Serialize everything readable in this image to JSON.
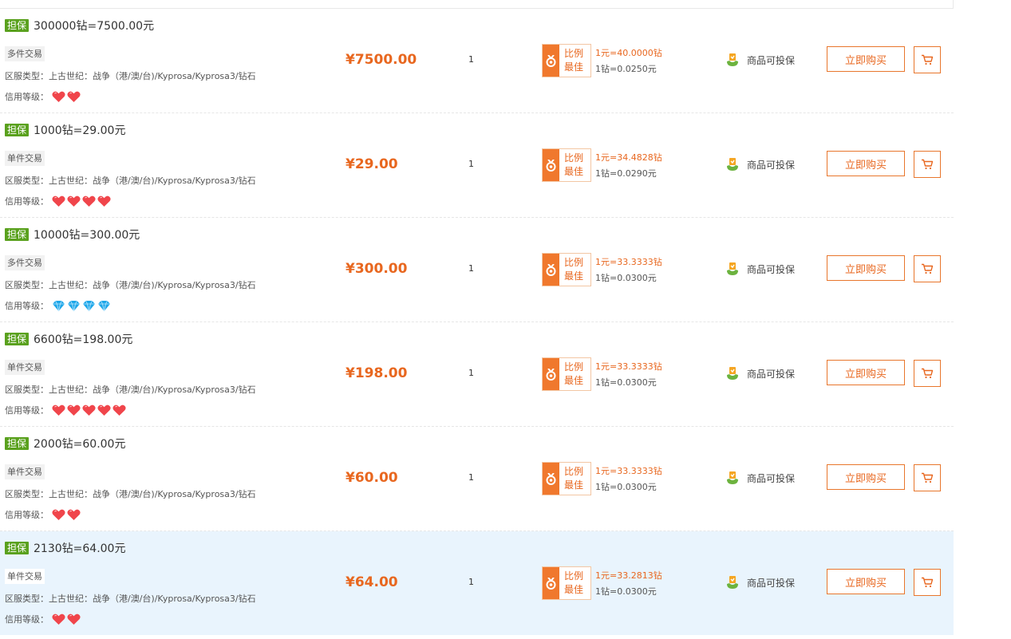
{
  "labels": {
    "guarantee": "担保",
    "server_prefix": "区服类型：",
    "credit_prefix": "信用等级：",
    "ratio_line1": "比例",
    "ratio_line2": "最佳",
    "insure": "商品可投保",
    "buy": "立即购买"
  },
  "colors": {
    "accent": "#e8671f",
    "guarantee_green": "#5aa11e",
    "highlight_row": "#e9f4fd",
    "heart": "#f0454b",
    "diamond": "#1ea7e8"
  },
  "listings": [
    {
      "title": "300000钻=7500.00元",
      "trade_type": "多件交易",
      "server": "上古世纪：战争（港/澳/台)/Kyprosa/Kyprosa3/钻石",
      "credit_icon": "heart",
      "credit_count": 2,
      "price": "¥7500.00",
      "qty": "1",
      "rate1": "1元=40.0000钻",
      "rate2": "1钻=0.0250元",
      "highlighted": false
    },
    {
      "title": "1000钻=29.00元",
      "trade_type": "单件交易",
      "server": "上古世纪：战争（港/澳/台)/Kyprosa/Kyprosa3/钻石",
      "credit_icon": "heart",
      "credit_count": 4,
      "price": "¥29.00",
      "qty": "1",
      "rate1": "1元=34.4828钻",
      "rate2": "1钻=0.0290元",
      "highlighted": false
    },
    {
      "title": "10000钻=300.00元",
      "trade_type": "多件交易",
      "server": "上古世纪：战争（港/澳/台)/Kyprosa/Kyprosa3/钻石",
      "credit_icon": "diamond",
      "credit_count": 4,
      "price": "¥300.00",
      "qty": "1",
      "rate1": "1元=33.3333钻",
      "rate2": "1钻=0.0300元",
      "highlighted": false
    },
    {
      "title": "6600钻=198.00元",
      "trade_type": "单件交易",
      "server": "上古世纪：战争（港/澳/台)/Kyprosa/Kyprosa3/钻石",
      "credit_icon": "heart",
      "credit_count": 5,
      "price": "¥198.00",
      "qty": "1",
      "rate1": "1元=33.3333钻",
      "rate2": "1钻=0.0300元",
      "highlighted": false
    },
    {
      "title": "2000钻=60.00元",
      "trade_type": "单件交易",
      "server": "上古世纪：战争（港/澳/台)/Kyprosa/Kyprosa3/钻石",
      "credit_icon": "heart",
      "credit_count": 2,
      "price": "¥60.00",
      "qty": "1",
      "rate1": "1元=33.3333钻",
      "rate2": "1钻=0.0300元",
      "highlighted": false
    },
    {
      "title": "2130钻=64.00元",
      "trade_type": "单件交易",
      "server": "上古世纪：战争（港/澳/台)/Kyprosa/Kyprosa3/钻石",
      "credit_icon": "heart",
      "credit_count": 2,
      "price": "¥64.00",
      "qty": "1",
      "rate1": "1元=33.2813钻",
      "rate2": "1钻=0.0300元",
      "highlighted": true
    }
  ]
}
